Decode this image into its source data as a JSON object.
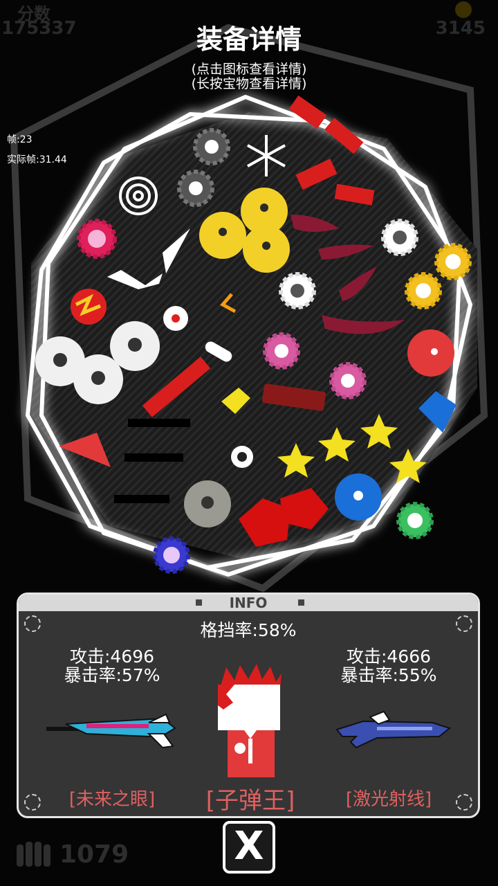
{
  "hud": {
    "score_label": "分数",
    "score_value": "175337",
    "coins_value": "3145"
  },
  "dialog": {
    "title": "装备详情",
    "hint_tap": "(点击图标查看详情)",
    "hint_hold": "(长按宝物查看详情)"
  },
  "debug": {
    "frame": "帧:23",
    "actual_frame": "实际帧:31.44"
  },
  "info_panel": {
    "header": "INFO",
    "block_rate": "格挡率:58%",
    "left_weapon": {
      "attack": "攻击:4696",
      "crit": "暴击率:57%",
      "name": "[未来之眼]"
    },
    "character": {
      "name": "[子弹王]"
    },
    "right_weapon": {
      "attack": "攻击:4666",
      "crit": "暴击率:55%",
      "name": "[激光射线]"
    }
  },
  "footer": {
    "ammo_count": "1079",
    "close_label": "X"
  },
  "colors": {
    "accent_red": "#e06060",
    "panel_bg": "#353535",
    "panel_border": "#e6e6e6"
  },
  "icons": [
    "coin-icon",
    "snowflake-icon",
    "spiral-icon",
    "bullet-icon",
    "close-icon"
  ]
}
